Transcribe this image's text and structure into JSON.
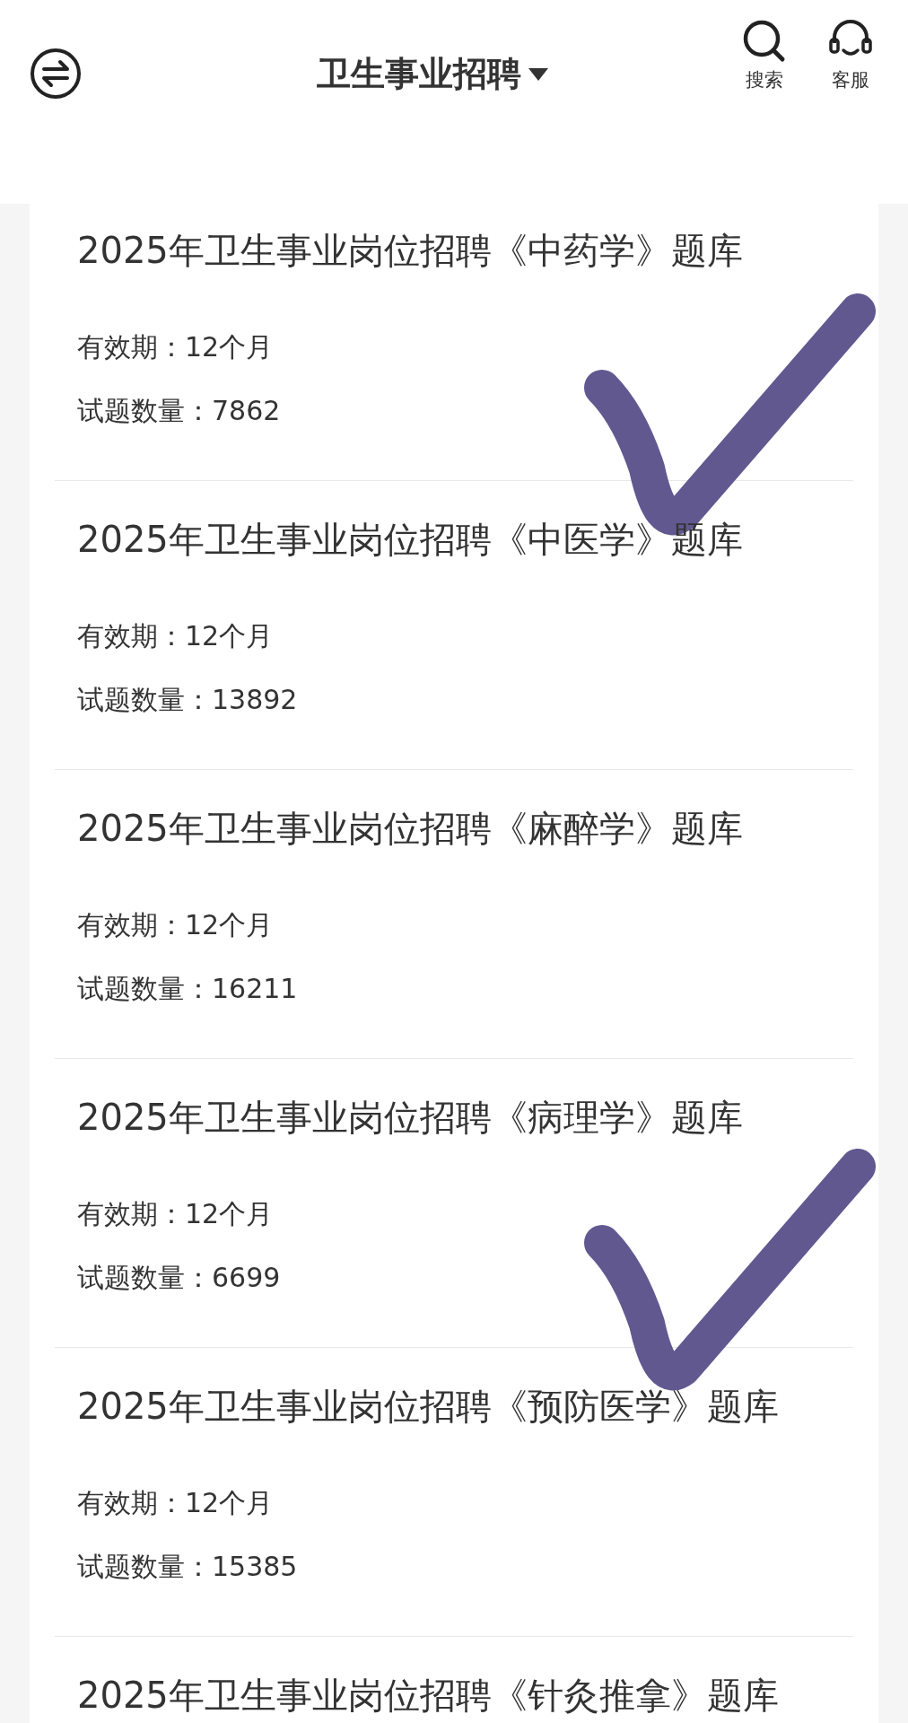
{
  "header": {
    "title": "卫生事业招聘",
    "actions": [
      {
        "kind": "search",
        "label": "搜索"
      },
      {
        "kind": "service",
        "label": "客服"
      }
    ]
  },
  "items": [
    {
      "title": "2025年卫生事业岗位招聘《中药学》题库",
      "validity": "有效期：12个月",
      "count": "试题数量：7862",
      "checked": true
    },
    {
      "title": "2025年卫生事业岗位招聘《中医学》题库",
      "validity": "有效期：12个月",
      "count": "试题数量：13892",
      "checked": false
    },
    {
      "title": "2025年卫生事业岗位招聘《麻醉学》题库",
      "validity": "有效期：12个月",
      "count": "试题数量：16211",
      "checked": false
    },
    {
      "title": "2025年卫生事业岗位招聘《病理学》题库",
      "validity": "有效期：12个月",
      "count": "试题数量：6699",
      "checked": true
    },
    {
      "title": "2025年卫生事业岗位招聘《预防医学》题库",
      "validity": "有效期：12个月",
      "count": "试题数量：15385",
      "checked": false
    },
    {
      "title": "2025年卫生事业岗位招聘《针灸推拿》题库"
    }
  ]
}
